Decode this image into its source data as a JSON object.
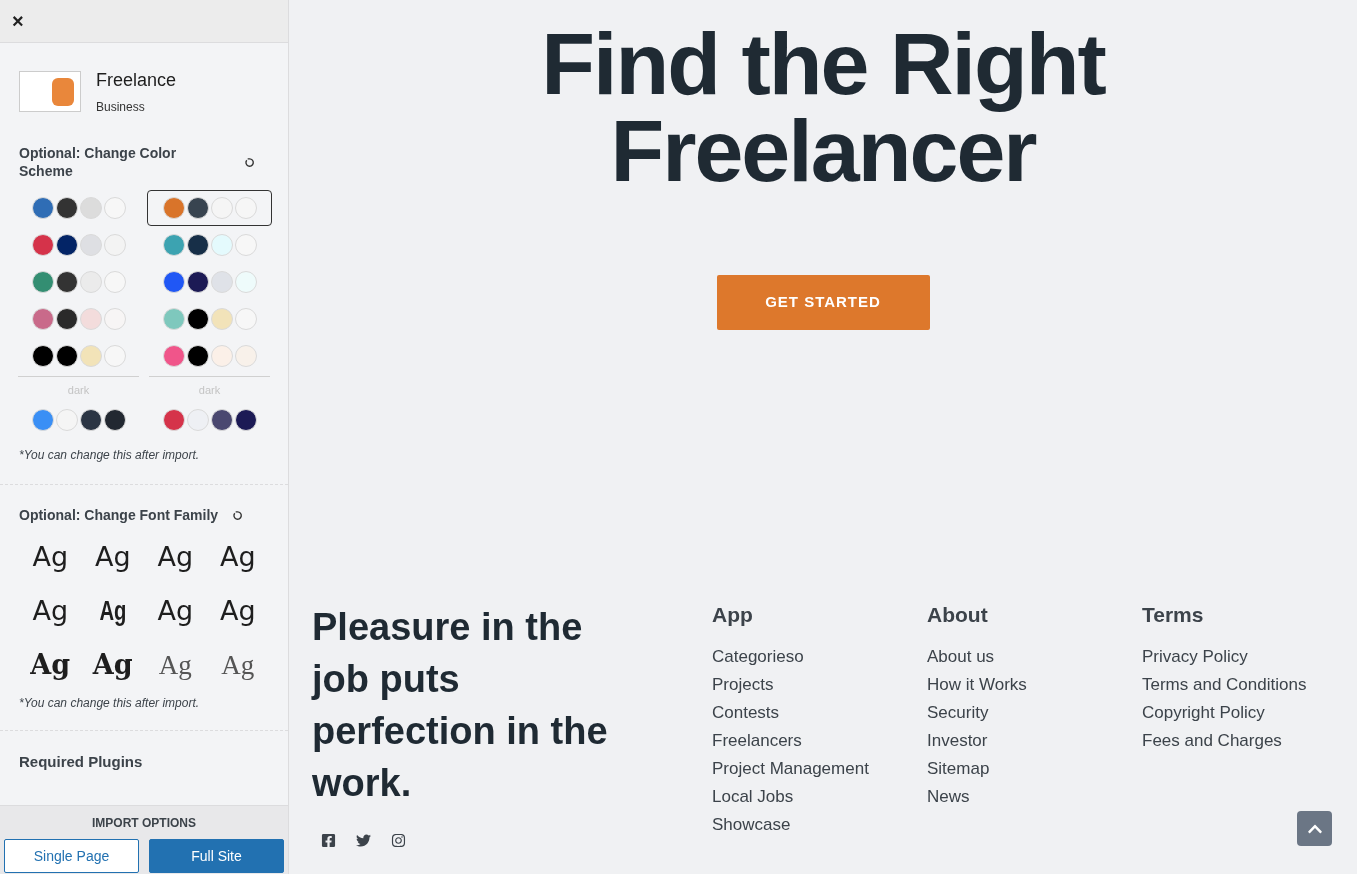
{
  "sidebar": {
    "close": "×",
    "theme": {
      "name": "Freelance",
      "category": "Business"
    },
    "color_scheme": {
      "title": "Optional: Change Color Scheme",
      "columns": [
        {
          "palettes": [
            {
              "colors": [
                {
                  "color": "#2f6db5"
                },
                {
                  "color": "#333333"
                },
                {
                  "color": "#dcdcdc"
                },
                {
                  "color": "#f7f7f7"
                }
              ],
              "selected": false
            },
            {
              "colors": [
                {
                  "color": "#d5334a"
                },
                {
                  "color": "#032466"
                },
                {
                  "color": "#dedfe3"
                },
                {
                  "color": "#f3f3f3"
                }
              ],
              "selected": false
            },
            {
              "colors": [
                {
                  "color": "#338e72"
                },
                {
                  "color": "#333333"
                },
                {
                  "color": "#ebebeb"
                },
                {
                  "color": "#f7f7f7"
                }
              ],
              "selected": false
            },
            {
              "colors": [
                {
                  "color": "#c96a8a"
                },
                {
                  "color": "#2a2a2a"
                },
                {
                  "color": "#f3dcdc"
                },
                {
                  "color": "#f7f5f5"
                }
              ],
              "selected": false
            },
            {
              "colors": [
                {
                  "color": "#000000"
                },
                {
                  "color": "#000000"
                },
                {
                  "color": "#f2e3b8"
                },
                {
                  "color": "#f7f7f7"
                }
              ],
              "selected": false
            }
          ],
          "dark_label": "dark",
          "dark": {
            "colors": [
              {
                "color": "#3a8ff5"
              },
              {
                "color": "#f5f5f5"
              },
              {
                "color": "#2b3544"
              },
              {
                "color": "#222831"
              }
            ],
            "selected": false
          }
        },
        {
          "palettes": [
            {
              "colors": [
                {
                  "color": "#d9742a"
                },
                {
                  "color": "#384450"
                },
                {
                  "color": "#f5f5f5"
                },
                {
                  "color": "#f6f6f6"
                }
              ],
              "selected": true
            },
            {
              "colors": [
                {
                  "color": "#3ca3b1"
                },
                {
                  "color": "#172f48"
                },
                {
                  "color": "#e4fafd"
                },
                {
                  "color": "#f7f7f7"
                }
              ],
              "selected": false
            },
            {
              "colors": [
                {
                  "color": "#2057f5"
                },
                {
                  "color": "#1c1a55"
                },
                {
                  "color": "#dfe2e8"
                },
                {
                  "color": "#eefbfb"
                }
              ],
              "selected": false
            },
            {
              "colors": [
                {
                  "color": "#7ec8bd"
                },
                {
                  "color": "#000000"
                },
                {
                  "color": "#f2e3b9"
                },
                {
                  "color": "#f7f7f7"
                }
              ],
              "selected": false
            },
            {
              "colors": [
                {
                  "color": "#f0558a"
                },
                {
                  "color": "#000000"
                },
                {
                  "color": "#fbf0e8"
                },
                {
                  "color": "#f8f1ea"
                }
              ],
              "selected": false
            }
          ],
          "dark_label": "dark",
          "dark": {
            "colors": [
              {
                "color": "#d5334a"
              },
              {
                "color": "#eef0f4"
              },
              {
                "color": "#4a4870"
              },
              {
                "color": "#1c1a55"
              }
            ],
            "selected": false
          }
        }
      ],
      "note": "*You can change this after import."
    },
    "font_family": {
      "title": "Optional: Change Font Family",
      "samples": [
        {
          "label": "Ag",
          "kind": "sans"
        },
        {
          "label": "Ag",
          "kind": "sans"
        },
        {
          "label": "Ag",
          "kind": "sans"
        },
        {
          "label": "Ag",
          "kind": "sans"
        },
        {
          "label": "Ag",
          "kind": "sans"
        },
        {
          "label": "Ag",
          "kind": "condensed"
        },
        {
          "label": "Ag",
          "kind": "sans"
        },
        {
          "label": "Ag",
          "kind": "sans"
        },
        {
          "label": "Ag",
          "kind": "serif"
        },
        {
          "label": "Ag",
          "kind": "serif"
        },
        {
          "label": "Ag",
          "kind": "light-serif"
        },
        {
          "label": "Ag",
          "kind": "light-serif"
        }
      ],
      "note": "*You can change this after import."
    },
    "required_plugins": {
      "title": "Required Plugins"
    },
    "import_options": {
      "title": "IMPORT OPTIONS",
      "buttons": [
        {
          "label": "Single Page",
          "primary": false
        },
        {
          "label": "Full Site",
          "primary": true
        }
      ]
    }
  },
  "hero": {
    "headline": [
      "Find the Right",
      "Freelancer"
    ],
    "button": "GET STARTED"
  },
  "footer": {
    "tagline": "Pleasure in the job puts perfection in the work.",
    "columns": [
      {
        "title": "App",
        "links": [
          "Categorieso",
          "Projects",
          "Contests",
          "Freelancers",
          "Project Management",
          "Local Jobs",
          "Showcase"
        ]
      },
      {
        "title": "About",
        "links": [
          "About us",
          "How it Works",
          "Security",
          "Investor",
          "Sitemap",
          "News"
        ]
      },
      {
        "title": "Terms",
        "links": [
          "Privacy Policy",
          "Terms and Conditions",
          "Copyright Policy",
          "Fees and Charges"
        ]
      }
    ]
  }
}
